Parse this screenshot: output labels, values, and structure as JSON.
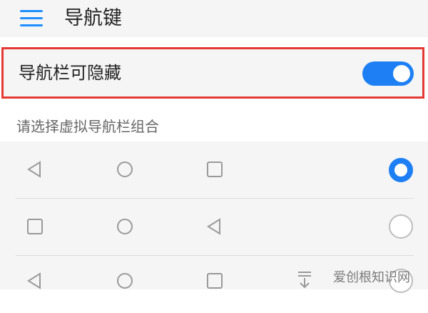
{
  "header": {
    "title": "导航键",
    "menu_icon": "menu-icon"
  },
  "hide_option": {
    "label": "导航栏可隐藏",
    "toggle_state": "on"
  },
  "section": {
    "title": "请选择虚拟导航栏组合"
  },
  "combos": [
    {
      "buttons": [
        "back",
        "home",
        "recent"
      ],
      "selected": true
    },
    {
      "buttons": [
        "recent",
        "home",
        "back"
      ],
      "selected": false
    },
    {
      "buttons": [
        "back",
        "home",
        "recent",
        "notification-pull-down"
      ],
      "selected": false
    }
  ],
  "watermark": "爱创根知识网",
  "colors": {
    "accent": "#1e7ff5",
    "highlight_border": "#e53935",
    "icon_gray": "#9a9a9a"
  }
}
